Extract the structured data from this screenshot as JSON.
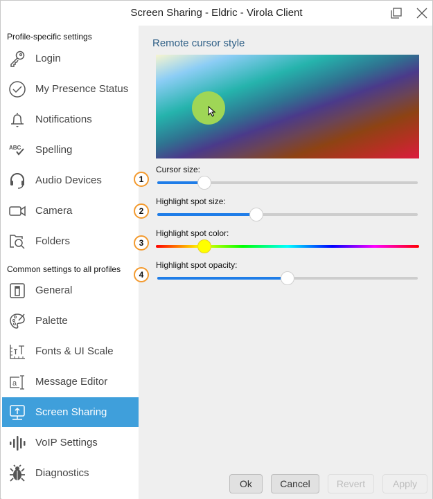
{
  "window": {
    "title": "Screen Sharing - Eldric - Virola Client",
    "controls": {
      "restore": "restore-icon",
      "close": "close-icon"
    }
  },
  "sidebar": {
    "profile_section_label": "Profile-specific settings",
    "common_section_label": "Common settings to all profiles",
    "profile_items": [
      {
        "label": "Login",
        "icon": "key-icon"
      },
      {
        "label": "My Presence Status",
        "icon": "check-circle-icon"
      },
      {
        "label": "Notifications",
        "icon": "bell-icon"
      },
      {
        "label": "Spelling",
        "icon": "spellcheck-icon"
      },
      {
        "label": "Audio Devices",
        "icon": "headset-icon"
      },
      {
        "label": "Camera",
        "icon": "camera-icon"
      },
      {
        "label": "Folders",
        "icon": "folder-search-icon"
      }
    ],
    "common_items": [
      {
        "label": "General",
        "icon": "general-icon"
      },
      {
        "label": "Palette",
        "icon": "palette-icon"
      },
      {
        "label": "Fonts & UI Scale",
        "icon": "font-scale-icon"
      },
      {
        "label": "Message Editor",
        "icon": "text-editor-icon"
      },
      {
        "label": "Screen Sharing",
        "icon": "screen-share-icon",
        "active": true
      },
      {
        "label": "VoIP Settings",
        "icon": "voice-wave-icon"
      },
      {
        "label": "Diagnostics",
        "icon": "bug-icon"
      }
    ],
    "active_color": "#3f9fdb"
  },
  "main": {
    "section_title": "Remote cursor style",
    "settings": [
      {
        "badge": "1",
        "label": "Cursor size:",
        "value": 0.18,
        "type": "normal"
      },
      {
        "badge": "2",
        "label": "Highlight spot size:",
        "value": 0.38,
        "type": "normal"
      },
      {
        "badge": "3",
        "label": "Highlight spot color:",
        "value": 0.18,
        "type": "hue",
        "color": "#ffff00"
      },
      {
        "badge": "4",
        "label": "Highlight spot opacity:",
        "value": 0.5,
        "type": "normal"
      }
    ],
    "highlight_spot_color": "#9fd656",
    "slider_accent": "#1f7de8",
    "badge_color": "#f39a2e"
  },
  "footer": {
    "ok": "Ok",
    "cancel": "Cancel",
    "revert": "Revert",
    "apply": "Apply"
  }
}
